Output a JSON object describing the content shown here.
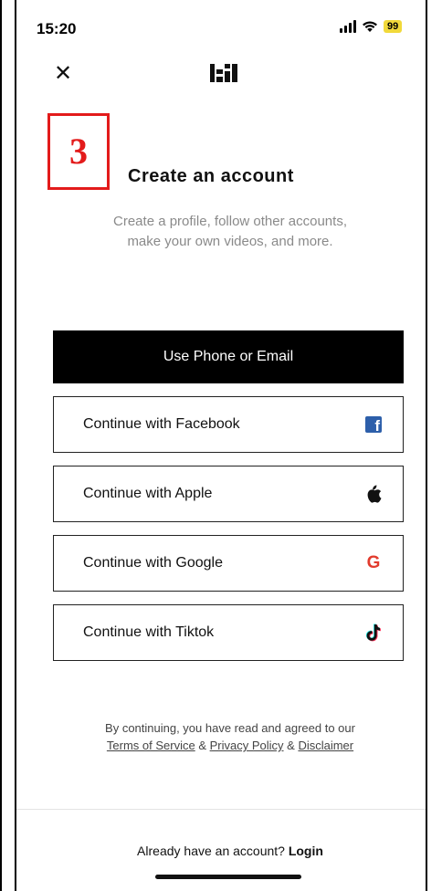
{
  "status_bar": {
    "time": "15:20",
    "battery": "99",
    "icons": [
      "signal-icon",
      "wifi-icon",
      "battery-icon"
    ]
  },
  "nav": {
    "close_icon": "close-icon",
    "logo_icon": "app-logo-icon"
  },
  "annotation": {
    "step_number": "3",
    "color": "#e31b1b"
  },
  "header": {
    "title": "Create an account",
    "subtitle_line1": "Create a profile, follow other accounts,",
    "subtitle_line2": "make your own videos, and more."
  },
  "buttons": {
    "phone_email": "Use Phone or Email",
    "facebook": "Continue with Facebook",
    "apple": "Continue with Apple",
    "google": "Continue with Google",
    "tiktok": "Continue with Tiktok"
  },
  "legal": {
    "prefix": "By continuing, you have read and agreed to our",
    "terms": "Terms of Service",
    "amp1": " & ",
    "privacy": "Privacy Policy",
    "amp2": " & ",
    "disclaimer": "Disclaimer"
  },
  "footer": {
    "question": "Already have an account? ",
    "login": "Login"
  },
  "colors": {
    "primary_button": "#000000",
    "facebook": "#2d5faa",
    "google": "#e23b2d",
    "battery": "#f1d93a"
  }
}
